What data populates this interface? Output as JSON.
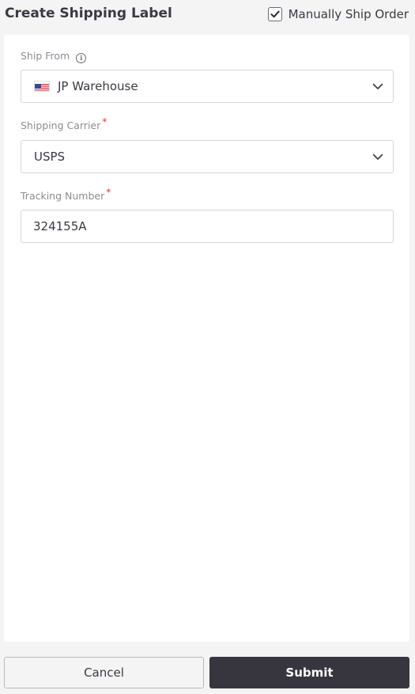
{
  "header": {
    "title": "Create Shipping Label",
    "manual_ship_label": "Manually Ship Order",
    "manual_ship_checked": true
  },
  "form": {
    "ship_from": {
      "label": "Ship From",
      "info_icon": "info-icon",
      "flag_icon": "us-flag-icon",
      "value": "JP Warehouse"
    },
    "carrier": {
      "label": "Shipping Carrier",
      "required_mark": "*",
      "value": "USPS"
    },
    "tracking": {
      "label": "Tracking Number",
      "required_mark": "*",
      "value": "324155A"
    }
  },
  "footer": {
    "cancel_label": "Cancel",
    "submit_label": "Submit"
  },
  "colors": {
    "primary_button": "#37363f",
    "required": "#e0343a",
    "page_background": "#f4f4f5"
  }
}
